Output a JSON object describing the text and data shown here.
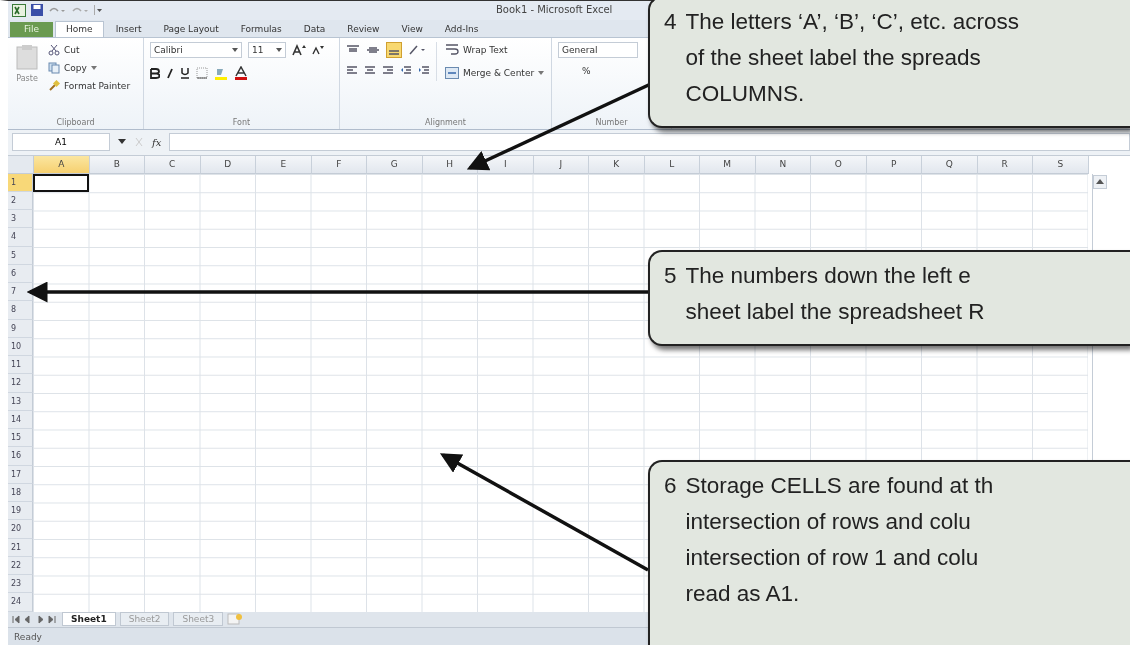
{
  "window": {
    "title": "Book1 - Microsoft Excel"
  },
  "ribbon_tabs": [
    {
      "label": "File",
      "kind": "file",
      "selected": false
    },
    {
      "label": "Home",
      "kind": "tab",
      "selected": true
    },
    {
      "label": "Insert",
      "kind": "tab",
      "selected": false
    },
    {
      "label": "Page Layout",
      "kind": "tab",
      "selected": false
    },
    {
      "label": "Formulas",
      "kind": "tab",
      "selected": false
    },
    {
      "label": "Data",
      "kind": "tab",
      "selected": false
    },
    {
      "label": "Review",
      "kind": "tab",
      "selected": false
    },
    {
      "label": "View",
      "kind": "tab",
      "selected": false
    },
    {
      "label": "Add-Ins",
      "kind": "tab",
      "selected": false
    }
  ],
  "ribbon": {
    "clipboard": {
      "paste": "Paste",
      "cut": "Cut",
      "copy": "Copy",
      "format_painter": "Format Painter",
      "label": "Clipboard"
    },
    "font": {
      "name": "Calibri",
      "size": "11",
      "label": "Font"
    },
    "alignment": {
      "wrap_text": "Wrap Text",
      "merge": "Merge & Center",
      "label": "Alignment"
    },
    "number": {
      "format": "General",
      "percent": "%",
      "label": "Number"
    }
  },
  "formula_bar": {
    "name_box": "A1",
    "fx": "fx"
  },
  "columns": [
    {
      "label": "A",
      "selected": true
    },
    {
      "label": "B",
      "selected": false
    },
    {
      "label": "C",
      "selected": false
    },
    {
      "label": "D",
      "selected": false
    },
    {
      "label": "E",
      "selected": false
    },
    {
      "label": "F",
      "selected": false
    },
    {
      "label": "G",
      "selected": false
    },
    {
      "label": "H",
      "selected": false
    },
    {
      "label": "I",
      "selected": false
    },
    {
      "label": "J",
      "selected": false
    },
    {
      "label": "K",
      "selected": false
    },
    {
      "label": "L",
      "selected": false
    },
    {
      "label": "M",
      "selected": false
    },
    {
      "label": "N",
      "selected": false
    },
    {
      "label": "O",
      "selected": false
    },
    {
      "label": "P",
      "selected": false
    },
    {
      "label": "Q",
      "selected": false
    },
    {
      "label": "R",
      "selected": false
    },
    {
      "label": "S",
      "selected": false
    }
  ],
  "rows": [
    {
      "label": "1",
      "selected": true
    },
    {
      "label": "2",
      "selected": false
    },
    {
      "label": "3",
      "selected": false
    },
    {
      "label": "4",
      "selected": false
    },
    {
      "label": "5",
      "selected": false
    },
    {
      "label": "6",
      "selected": false
    },
    {
      "label": "7",
      "selected": false
    },
    {
      "label": "8",
      "selected": false
    },
    {
      "label": "9",
      "selected": false
    },
    {
      "label": "10",
      "selected": false
    },
    {
      "label": "11",
      "selected": false
    },
    {
      "label": "12",
      "selected": false
    },
    {
      "label": "13",
      "selected": false
    },
    {
      "label": "14",
      "selected": false
    },
    {
      "label": "15",
      "selected": false
    },
    {
      "label": "16",
      "selected": false
    },
    {
      "label": "17",
      "selected": false
    },
    {
      "label": "18",
      "selected": false
    },
    {
      "label": "19",
      "selected": false
    },
    {
      "label": "20",
      "selected": false
    },
    {
      "label": "21",
      "selected": false
    },
    {
      "label": "22",
      "selected": false
    },
    {
      "label": "23",
      "selected": false
    },
    {
      "label": "24",
      "selected": false
    }
  ],
  "sheet_tabs": [
    {
      "label": "Sheet1",
      "selected": true
    },
    {
      "label": "Sheet2",
      "selected": false
    },
    {
      "label": "Sheet3",
      "selected": false
    }
  ],
  "status_bar": {
    "text": "Ready"
  },
  "callouts": [
    {
      "number": "4",
      "lines": [
        "The letters ‘A’, ‘B’, ‘C’, etc. across",
        "of the sheet label the spreads",
        "COLUMNS."
      ]
    },
    {
      "number": "5",
      "lines": [
        "The numbers down the left e",
        "sheet label the spreadsheet R"
      ]
    },
    {
      "number": "6",
      "lines": [
        "Storage CELLS are found at th",
        "intersection of rows and colu",
        "intersection of row 1 and colu",
        "read as A1."
      ]
    }
  ]
}
